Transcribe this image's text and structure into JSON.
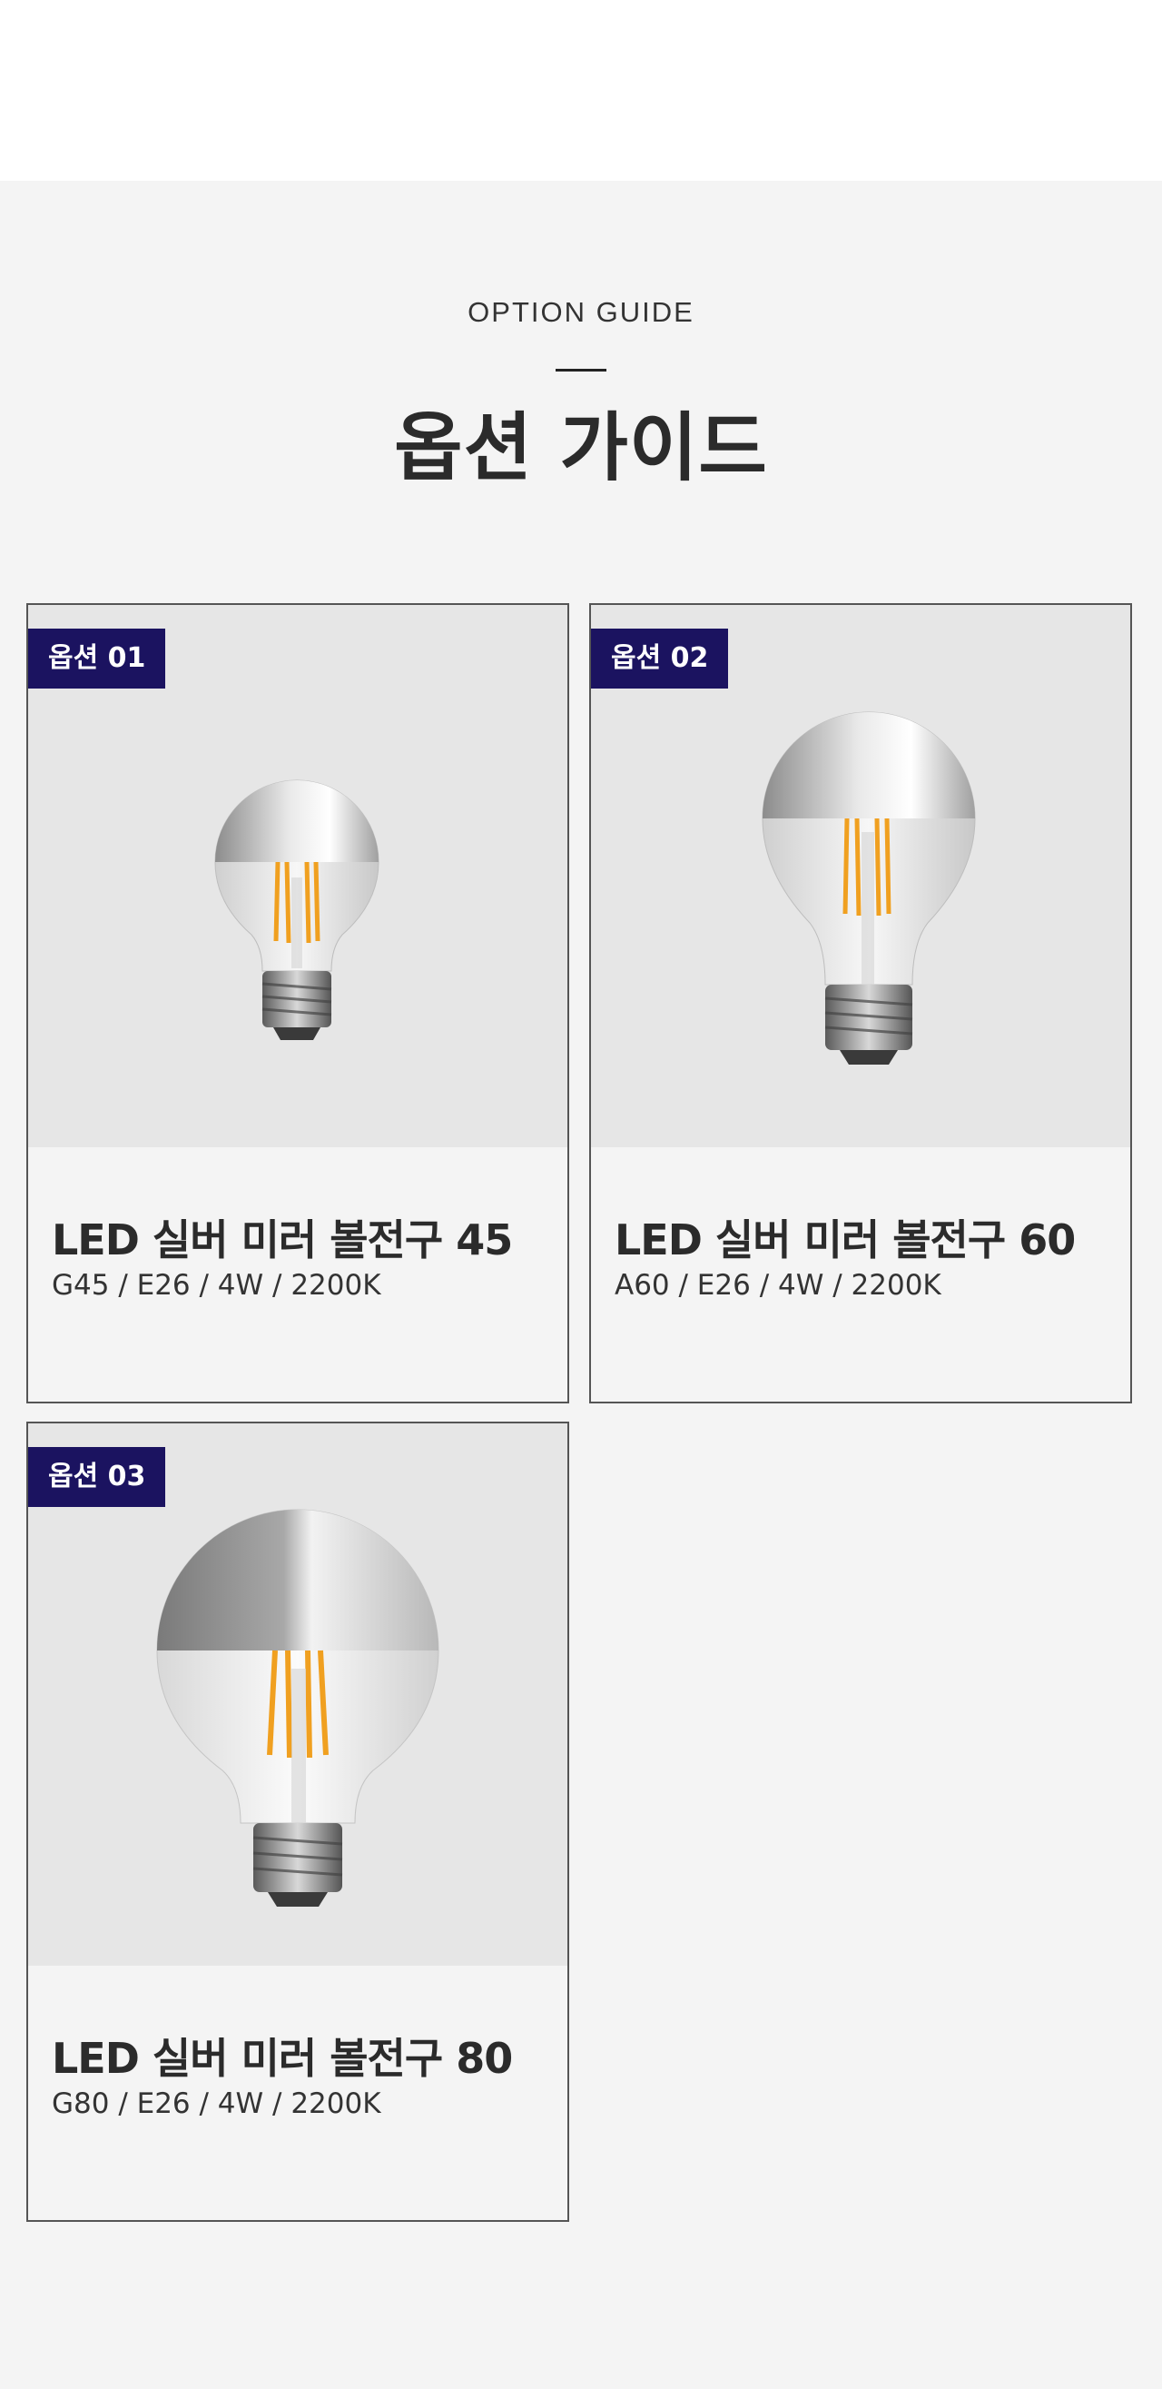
{
  "header": {
    "eyebrow": "OPTION GUIDE",
    "title": "옵션 가이드"
  },
  "options": [
    {
      "badge": "옵션 01",
      "name": "LED 실버 미러 볼전구 45",
      "spec": "G45 / E26 / 4W / 2200K",
      "image": "bulb-g45-icon"
    },
    {
      "badge": "옵션 02",
      "name": "LED 실버 미러 볼전구 60",
      "spec": "A60 / E26 / 4W / 2200K",
      "image": "bulb-a60-icon"
    },
    {
      "badge": "옵션 03",
      "name": "LED 실버 미러 볼전구 80",
      "spec": "G80 / E26 / 4W / 2200K",
      "image": "bulb-g80-icon"
    }
  ],
  "colors": {
    "badge_bg": "#1b1360",
    "section_bg": "#f4f4f4",
    "image_bg": "#e6e6e6",
    "filament": "#f0a020"
  }
}
